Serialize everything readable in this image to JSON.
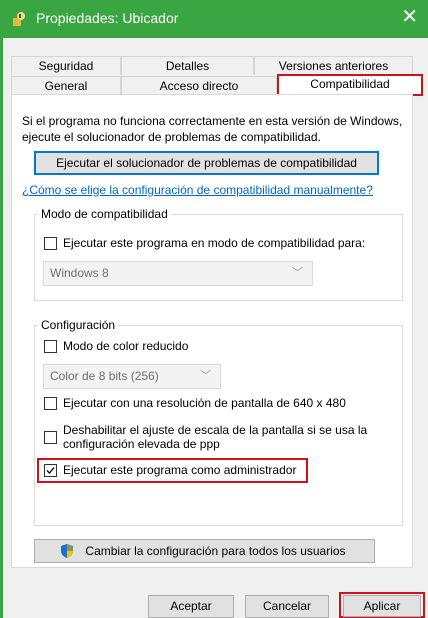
{
  "window": {
    "title": "Propiedades: Ubicador",
    "close_glyph": "✕"
  },
  "tabs_back": [
    {
      "label": "Seguridad"
    },
    {
      "label": "Detalles"
    },
    {
      "label": "Versiones anteriores"
    }
  ],
  "tabs_front": [
    {
      "label": "General"
    },
    {
      "label": "Acceso directo"
    },
    {
      "label": "Compatibilidad"
    }
  ],
  "intro_text": "Si el programa no funciona correctamente en esta versión de Windows, ejecute el solucionador de problemas de compatibilidad.",
  "troubleshooter_button": "Ejecutar el solucionador de problemas de compatibilidad",
  "manual_link": "¿Cómo se elige la configuración de compatibilidad manualmente?",
  "compat_group": {
    "title": "Modo de compatibilidad",
    "checkbox_label": "Ejecutar este programa en modo de compatibilidad para:",
    "checked": false,
    "select_value": "Windows 8"
  },
  "settings_group": {
    "title": "Configuración",
    "reduced_color_label": "Modo de color reducido",
    "reduced_color_checked": false,
    "color_select_value": "Color de 8 bits (256)",
    "resolution_label": "Ejecutar con una resolución de pantalla de 640 x 480",
    "resolution_checked": false,
    "dpi_label_1": "Deshabilitar el ajuste de escala de la pantalla si se usa la",
    "dpi_label_2": "configuración elevada de ppp",
    "dpi_checked": false,
    "admin_label": "Ejecutar este programa como administrador",
    "admin_checked": true
  },
  "all_users_button": "Cambiar la configuración para todos los usuarios",
  "footer": {
    "ok": "Aceptar",
    "cancel": "Cancelar",
    "apply": "Aplicar"
  },
  "colors": {
    "title_bar": "#3aa641",
    "highlight": "#d0101b",
    "link": "#0066cc",
    "focus_border": "#0078d7"
  }
}
